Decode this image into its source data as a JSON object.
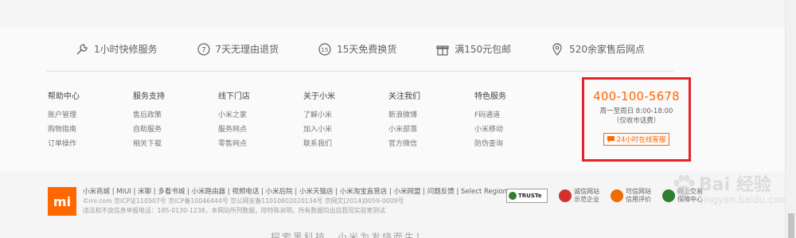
{
  "services": [
    {
      "icon": "wrench-icon",
      "label": "1小时快修服务"
    },
    {
      "icon": "return-7-icon",
      "label": "7天无理由退货"
    },
    {
      "icon": "exchange-15-icon",
      "label": "15天免费换货"
    },
    {
      "icon": "gift-icon",
      "label": "满150元包邮"
    },
    {
      "icon": "location-pin-icon",
      "label": "520余家售后网点"
    }
  ],
  "columns": [
    {
      "title": "帮助中心",
      "items": [
        "账户管理",
        "购物指南",
        "订单操作"
      ]
    },
    {
      "title": "服务支持",
      "items": [
        "售后政策",
        "自助服务",
        "相关下载"
      ]
    },
    {
      "title": "线下门店",
      "items": [
        "小米之家",
        "服务网点",
        "零售网点"
      ]
    },
    {
      "title": "关于小米",
      "items": [
        "了解小米",
        "加入小米",
        "联系我们"
      ]
    },
    {
      "title": "关注我们",
      "items": [
        "新浪微博",
        "小米部落",
        "官方微信"
      ]
    },
    {
      "title": "特色服务",
      "items": [
        "F码通道",
        "小米移动",
        "防伪查询"
      ]
    }
  ],
  "contact": {
    "phone": "400-100-5678",
    "hours": "周一至周日 8:00-18:00",
    "fee_note": "（仅收市话费）",
    "chat_label": "24小时在线客服"
  },
  "legal": {
    "logo_text": "mi",
    "nav": "小米商城 | MIUI | 米聊 | 多看书城 | 小米路由器 | 视频电话 | 小米后院 | 小米天猫店 | 小米淘宝直营店 | 小米网盟 | 问题反馈 | Select Region",
    "icp": "©mi.com 京ICP证110507号 京ICP备10046444号 京公网安备11010802020134号 京网文[2014]0059-0009号",
    "report": "违法和不良信息举报电话：185-0130-1238，本网站所列数据，除特殊说明，所有数据均出自我司实验室测试"
  },
  "badges": {
    "truste": "TRUSTe",
    "b1_line1": "诚信网站",
    "b1_line2": "示范企业",
    "b2_line1": "可信网站",
    "b2_line2": "信用评价",
    "b3_line1": "网上交易",
    "b3_line2": "保障中心"
  },
  "slogan": "探索黑科技，小米为发烧而生！",
  "watermark": {
    "line1": "Bai 经验",
    "line2": "jingyan.baidu.com"
  },
  "colors": {
    "accent": "#ff6700",
    "highlight_border": "#e3242b"
  }
}
